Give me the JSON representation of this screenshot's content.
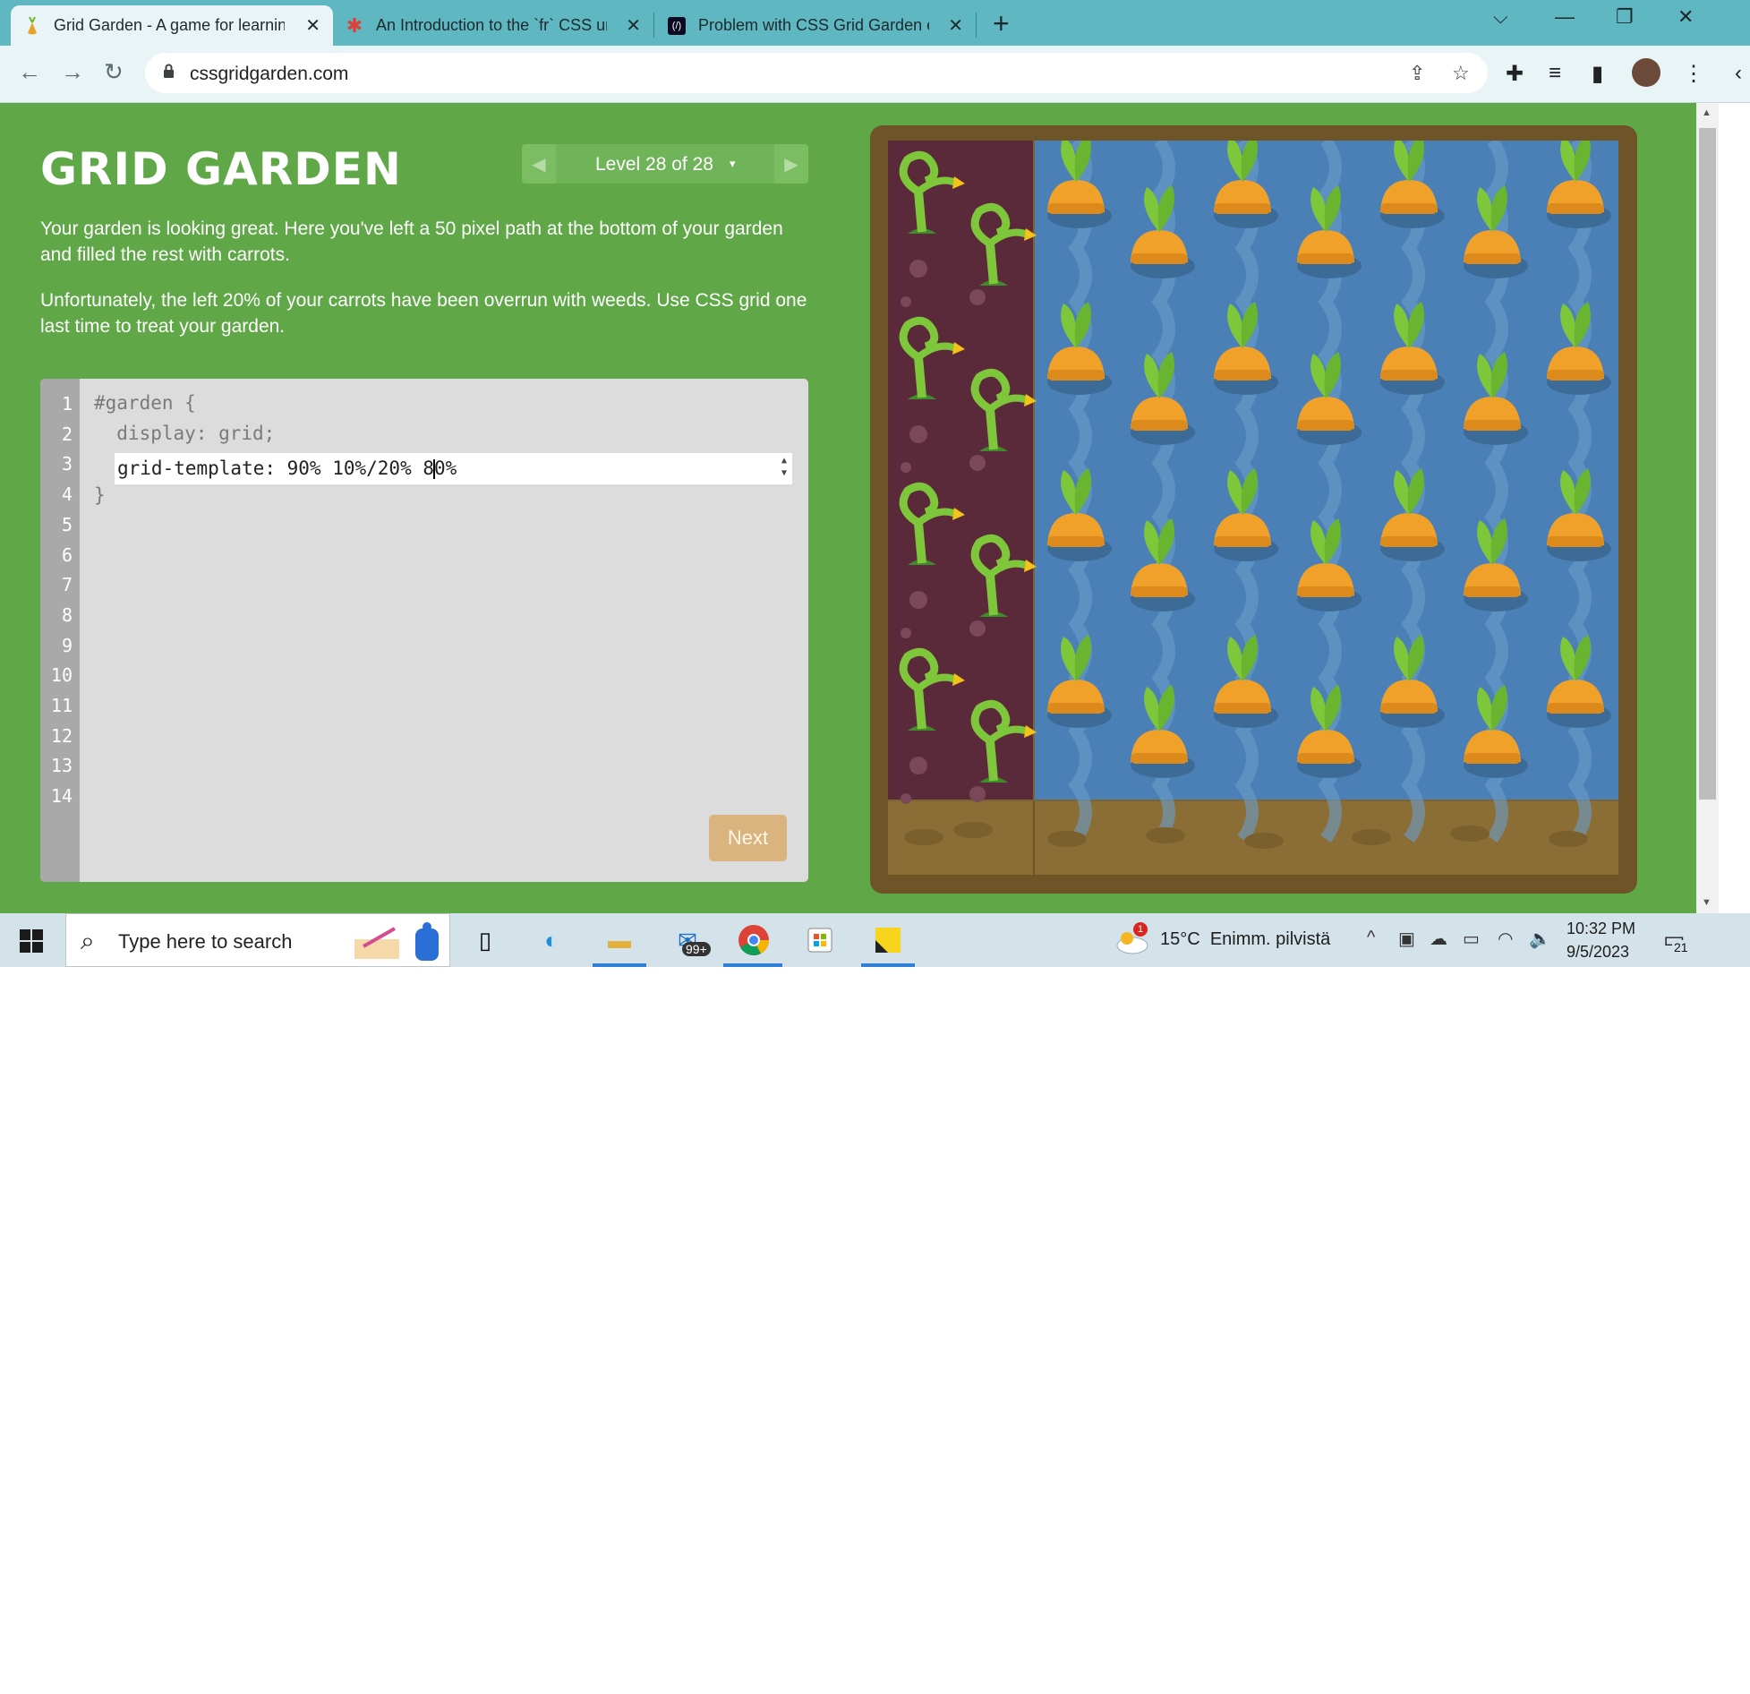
{
  "browser": {
    "tabs": [
      {
        "title": "Grid Garden - A game for learnin",
        "close": "✕",
        "active": true
      },
      {
        "title": "An Introduction to the `fr` CSS un",
        "close": "✕",
        "active": false
      },
      {
        "title": "Problem with CSS Grid Garden ex",
        "close": "✕",
        "active": false
      }
    ],
    "new_tab": "+",
    "url": "cssgridgarden.com",
    "window_controls": [
      "⌵",
      "—",
      "❐",
      "✕"
    ]
  },
  "game": {
    "title": "GRID GARDEN",
    "level_label": "Level 28 of 28",
    "level_caret": "▾",
    "prev_arrow": "◀",
    "next_arrow": "▶",
    "instructions": [
      "Your garden is looking great. Here you've left a 50 pixel path at the bottom of your garden and filled the rest with carrots.",
      "Unfortunately, the left 20% of your carrots have been overrun with weeds. Use CSS grid one last time to treat your garden."
    ],
    "editor": {
      "line_numbers": [
        "1",
        "2",
        "3",
        "4",
        "5",
        "6",
        "7",
        "8",
        "9",
        "10",
        "11",
        "12",
        "13",
        "14"
      ],
      "line1": "#garden {",
      "line2": "  display: grid;",
      "input_before_caret": "grid-template: 90% 10%/20% 8",
      "input_after_caret": "0%",
      "line4": "}",
      "next_button": "Next"
    },
    "garden": {
      "weed_rows": 4,
      "carrot_columns": 7,
      "colors": {
        "weeds_bg": "#5a2a3a",
        "water": "#4a80b5",
        "path": "#8a6e35",
        "carrot": "#f0a12a",
        "leaf": "#7ec63a"
      }
    }
  },
  "taskbar": {
    "search_placeholder": "Type here to search",
    "badge_mail": "99+",
    "weather_temp": "15°C",
    "weather_desc": "Enimm. pilvistä",
    "weather_alert": "1",
    "time": "10:32 PM",
    "date": "9/5/2023",
    "notifications": "21"
  }
}
